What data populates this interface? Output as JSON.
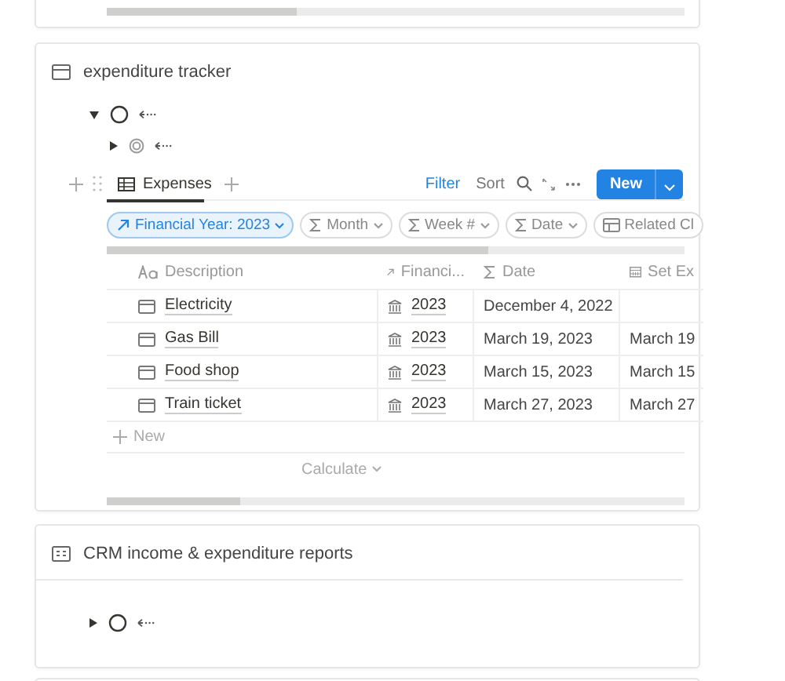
{
  "tracker": {
    "title": "expenditure tracker",
    "tree": [
      {
        "kind": "circle",
        "expanded": true,
        "children": [
          {
            "kind": "target",
            "expanded": false
          }
        ]
      }
    ],
    "view_tab": {
      "label": "Expenses",
      "selected": true
    },
    "toolbar": [
      "Filter",
      "Sort"
    ],
    "new_button": "New",
    "filters": [
      {
        "kind": "arrow",
        "label": "Financial Year: 2023",
        "active": true
      },
      {
        "kind": "sum",
        "label": "Month",
        "active": false
      },
      {
        "kind": "sum",
        "label": "Week #",
        "active": false
      },
      {
        "kind": "sum",
        "label": "Date",
        "active": false
      },
      {
        "kind": "relation",
        "label": "Related Cl",
        "active": false
      }
    ],
    "table": {
      "columns": [
        {
          "kind": "text",
          "label": "Description"
        },
        {
          "kind": "arrow",
          "label": "Financi..."
        },
        {
          "kind": "sum",
          "label": "Date"
        },
        {
          "kind": "calendar",
          "label": "Set Ex"
        }
      ],
      "rows": [
        {
          "description": "Electricity",
          "year": "2023",
          "date": "December 4, 2022"
        },
        {
          "description": "Gas Bill",
          "year": "2023",
          "date": "March 19, 2023",
          "set_ex": "March 19"
        },
        {
          "description": "Food shop",
          "year": "2023",
          "date": "March 15, 2023",
          "set_ex": "March 15"
        },
        {
          "description": "Train ticket",
          "year": "2023",
          "date": "March 27, 2023",
          "set_ex": "March 27"
        }
      ],
      "new_row": "New",
      "calculate": "Calculate"
    }
  },
  "crm": {
    "title": "CRM income & expenditure reports",
    "tree": [
      {
        "kind": "circle",
        "expanded": false
      }
    ]
  }
}
